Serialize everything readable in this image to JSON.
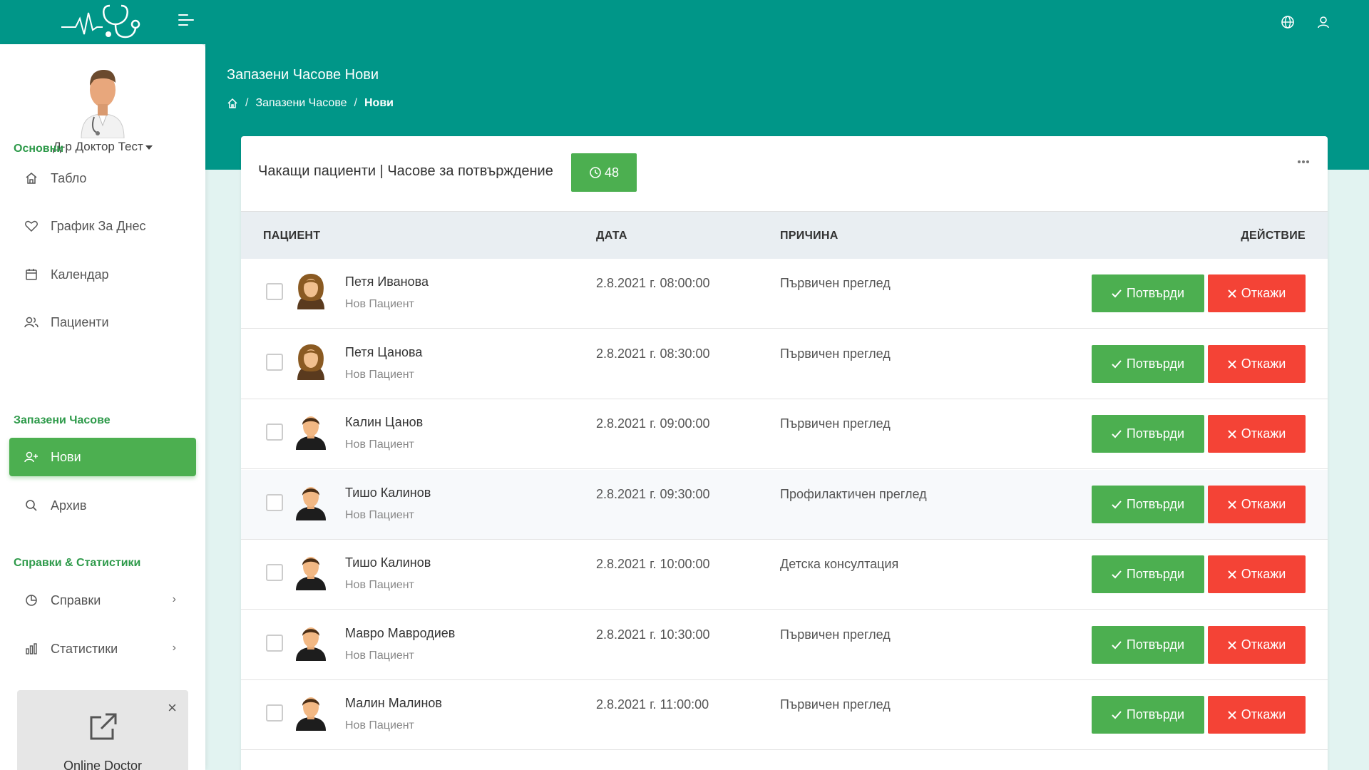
{
  "header": {
    "page_title": "Запазени Часове Нови"
  },
  "breadcrumb": {
    "home_icon": "home-icon",
    "items": [
      "Запазени Часове",
      "Нови"
    ],
    "separator": "/"
  },
  "profile": {
    "name": "Д-р Доктор Тест"
  },
  "sidebar": {
    "sections": [
      "Основни",
      "Запазени Часове",
      "Справки & Статистики"
    ],
    "items": [
      {
        "label": "Табло",
        "icon": "home-icon"
      },
      {
        "label": "График За Днес",
        "icon": "heart-icon"
      },
      {
        "label": "Календар",
        "icon": "calendar-icon"
      },
      {
        "label": "Пациенти",
        "icon": "users-icon"
      },
      {
        "label": "Нови",
        "icon": "user-plus-icon",
        "active": true
      },
      {
        "label": "Архив",
        "icon": "search-icon"
      },
      {
        "label": "Справки",
        "icon": "pie-chart-icon"
      },
      {
        "label": "Статистики",
        "icon": "bar-chart-icon"
      }
    ]
  },
  "promo": {
    "text": "Online Doctor",
    "icon": "external-link-icon",
    "close": "×"
  },
  "card": {
    "title": "Чакащи пациенти | Часове за потвърждение",
    "badge_count": "48"
  },
  "table": {
    "headers": [
      "ПАЦИЕНТ",
      "ДАТА",
      "ПРИЧИНА",
      "ДЕЙСТВИЕ"
    ],
    "confirm_label": "Потвърди",
    "reject_label": "Откажи",
    "rows": [
      {
        "name": "Петя Иванова",
        "status": "Нов Пациент",
        "date": "2.8.2021 г. 08:00:00",
        "reason": "Първичен преглед",
        "gender": "female"
      },
      {
        "name": "Петя Цанова",
        "status": "Нов Пациент",
        "date": "2.8.2021 г. 08:30:00",
        "reason": "Първичен преглед",
        "gender": "female"
      },
      {
        "name": "Калин Цанов",
        "status": "Нов Пациент",
        "date": "2.8.2021 г. 09:00:00",
        "reason": "Първичен преглед",
        "gender": "male"
      },
      {
        "name": "Тишо Калинов",
        "status": "Нов Пациент",
        "date": "2.8.2021 г. 09:30:00",
        "reason": "Профилактичен преглед",
        "gender": "male"
      },
      {
        "name": "Тишо Калинов",
        "status": "Нов Пациент",
        "date": "2.8.2021 г. 10:00:00",
        "reason": "Детска консултация",
        "gender": "male"
      },
      {
        "name": "Мавро Мавродиев",
        "status": "Нов Пациент",
        "date": "2.8.2021 г. 10:30:00",
        "reason": "Първичен преглед",
        "gender": "male"
      },
      {
        "name": "Малин Малинов",
        "status": "Нов Пациент",
        "date": "2.8.2021 г. 11:00:00",
        "reason": "Първичен преглед",
        "gender": "male"
      }
    ]
  },
  "colors": {
    "primary": "#009688",
    "success": "#4caf50",
    "danger": "#f44336",
    "background": "#e2f3f1"
  }
}
